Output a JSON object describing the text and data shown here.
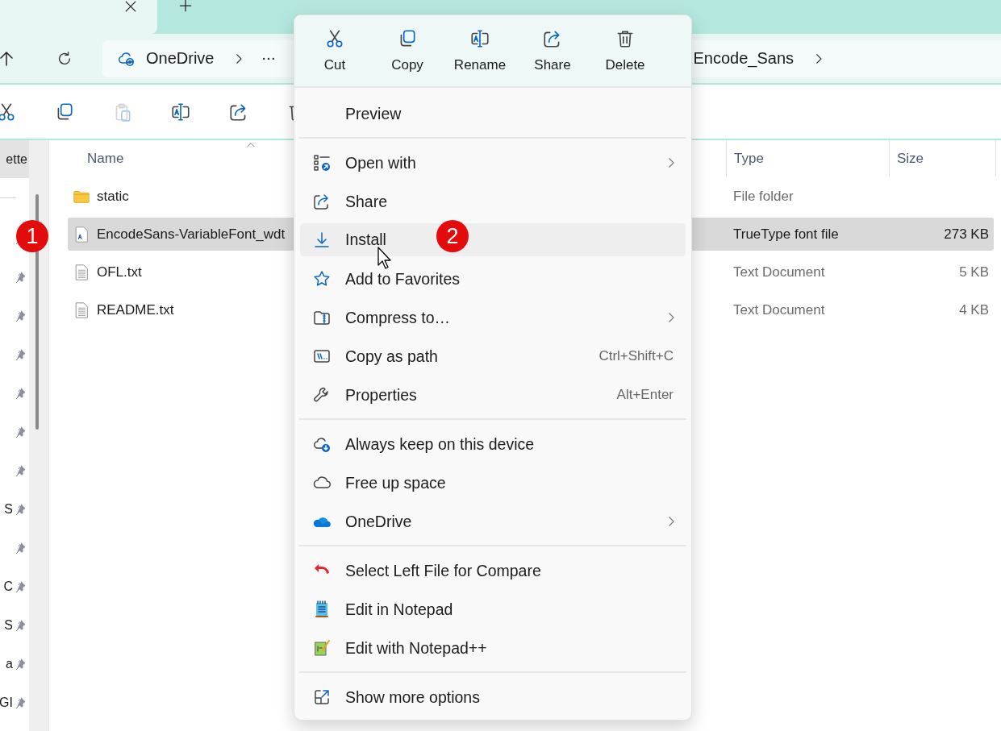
{
  "tabs": [
    {
      "selected": true
    }
  ],
  "address_bar": {
    "crumbs": [
      {
        "kind": "root",
        "label": "OneDrive"
      },
      {
        "kind": "overflow"
      },
      {
        "kind": "folder",
        "label": "Encode_Sans"
      }
    ]
  },
  "toolbar": [
    {
      "disabled": false
    },
    {
      "disabled": false
    },
    {
      "disabled": true
    },
    {
      "disabled": false
    },
    {
      "disabled": false
    },
    {
      "disabled": false
    }
  ],
  "sidebar": {
    "sections": [
      [
        {
          "label": "ette",
          "selected": true,
          "pinned": false
        }
      ],
      [
        {
          "selected": false,
          "pinned": true
        },
        {
          "selected": false,
          "pinned": true
        },
        {
          "selected": false,
          "pinned": true
        },
        {
          "selected": false,
          "pinned": true
        },
        {
          "selected": false,
          "pinned": true
        },
        {
          "selected": false,
          "pinned": true
        },
        {
          "selected": false,
          "pinned": true
        },
        {
          "label": "S",
          "selected": false,
          "pinned": true
        },
        {
          "selected": false,
          "pinned": true
        },
        {
          "label": "C",
          "selected": false,
          "pinned": true
        },
        {
          "label": "S",
          "selected": false,
          "pinned": true
        },
        {
          "label": "a",
          "selected": false,
          "pinned": true
        },
        {
          "label": "GI",
          "selected": false,
          "pinned": true
        }
      ]
    ]
  },
  "file_list": {
    "columns": [
      {
        "label": "Name",
        "sorted": true
      },
      {
        "label": "Type",
        "sorted": false
      },
      {
        "label": "Size",
        "sorted": false
      }
    ],
    "rows": [
      {
        "kind": "folder",
        "name": "static",
        "type": "File folder",
        "selected": false
      },
      {
        "kind": "font",
        "name": "EncodeSans-VariableFont_wdt",
        "type": "TrueType font file",
        "size": "273 KB",
        "selected": true
      },
      {
        "kind": "text",
        "name": "OFL.txt",
        "type": "Text Document",
        "size": "5 KB",
        "selected": false
      },
      {
        "kind": "text",
        "name": "README.txt",
        "type": "Text Document",
        "size": "4 KB",
        "selected": false
      }
    ]
  },
  "context_menu": {
    "actions": [
      {
        "label": "Cut"
      },
      {
        "label": "Copy"
      },
      {
        "label": "Rename"
      },
      {
        "label": "Share"
      },
      {
        "label": "Delete"
      }
    ],
    "groups": [
      [
        {
          "label": "Preview",
          "submenu": false,
          "highlighted": false
        }
      ],
      [
        {
          "label": "Open with",
          "submenu": true,
          "highlighted": false
        },
        {
          "label": "Share",
          "submenu": false,
          "highlighted": false
        },
        {
          "label": "Install",
          "submenu": false,
          "highlighted": true
        },
        {
          "label": "Add to Favorites",
          "submenu": false,
          "highlighted": false
        },
        {
          "label": "Compress to…",
          "submenu": true,
          "highlighted": false
        },
        {
          "label": "Copy as path",
          "shortcut": "Ctrl+Shift+C",
          "submenu": false,
          "highlighted": false
        },
        {
          "label": "Properties",
          "shortcut": "Alt+Enter",
          "submenu": false,
          "highlighted": false
        }
      ],
      [
        {
          "label": "Always keep on this device",
          "submenu": false,
          "highlighted": false
        },
        {
          "label": "Free up space",
          "submenu": false,
          "highlighted": false
        },
        {
          "label": "OneDrive",
          "submenu": true,
          "highlighted": false
        }
      ],
      [
        {
          "label": "Select Left File for Compare",
          "submenu": false,
          "highlighted": false
        },
        {
          "label": "Edit in Notepad",
          "submenu": false,
          "highlighted": false
        },
        {
          "label": "Edit with Notepad++",
          "submenu": false,
          "highlighted": false
        }
      ],
      [
        {
          "label": "Show more options",
          "submenu": false,
          "highlighted": false
        }
      ]
    ]
  },
  "annotations": [
    {
      "label": "1"
    },
    {
      "label": "2"
    }
  ]
}
